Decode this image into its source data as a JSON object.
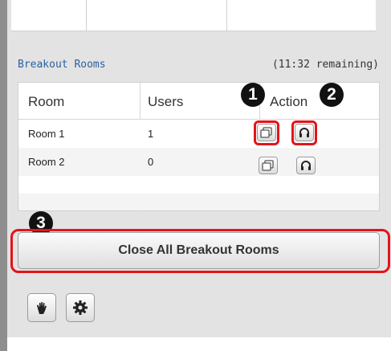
{
  "breakout": {
    "section_title": "Breakout Rooms",
    "remaining": "(11:32 remaining)",
    "columns": {
      "room": "Room",
      "users": "Users",
      "action": "Action"
    },
    "rows": [
      {
        "room": "Room 1",
        "users": "1"
      },
      {
        "room": "Room 2",
        "users": "0"
      }
    ],
    "close_all_label": "Close All Breakout Rooms"
  },
  "callouts": {
    "one": "1",
    "two": "2",
    "three": "3"
  },
  "icons": {
    "join": "copy-window-icon",
    "listen": "headphones-icon",
    "raise_hand": "raise-hand-icon",
    "settings": "gear-icon"
  },
  "colors": {
    "highlight": "#e3141a",
    "title": "#2a5fa0"
  }
}
